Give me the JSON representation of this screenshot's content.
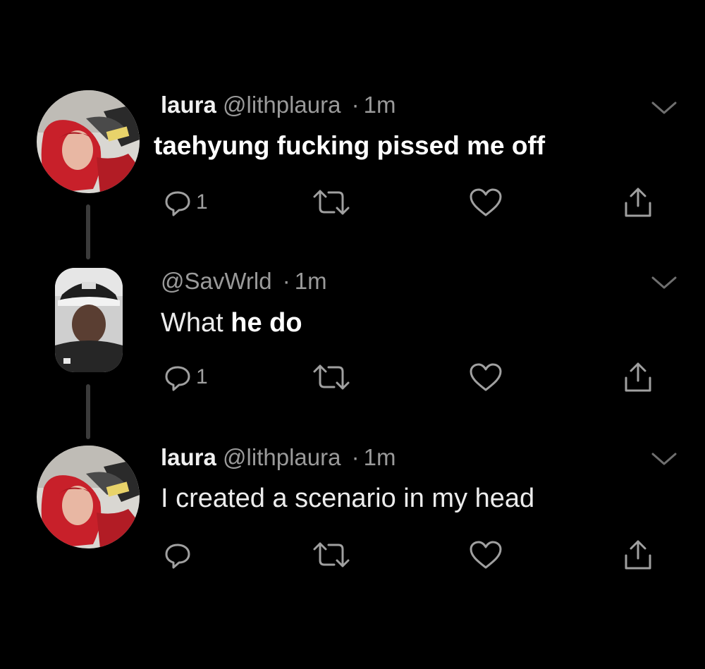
{
  "tweets": [
    {
      "name": "laura",
      "handle": "@lithplaura",
      "dot": "·",
      "time": "1m",
      "text": "taehyung fucking pissed me off",
      "reply_count": "1",
      "avatar": "red-hair-avatar"
    },
    {
      "name": "",
      "handle": "@SavWrld",
      "dot": "·",
      "time": "1m",
      "text_original": "What",
      "text_overlay": "he do",
      "reply_count": "1",
      "avatar": "cap-avatar"
    },
    {
      "name": "laura",
      "handle": "@lithplaura",
      "dot": "·",
      "time": "1m",
      "text": "I created a scenario in my head",
      "reply_count": "",
      "avatar": "red-hair-avatar"
    }
  ],
  "icons": {
    "reply": "reply-icon",
    "retweet": "retweet-icon",
    "like": "heart-icon",
    "share": "share-icon",
    "more": "chevron-down-icon"
  },
  "colors": {
    "background": "#000000",
    "icon": "#9a9a9a",
    "text": "#e7e7e7"
  }
}
